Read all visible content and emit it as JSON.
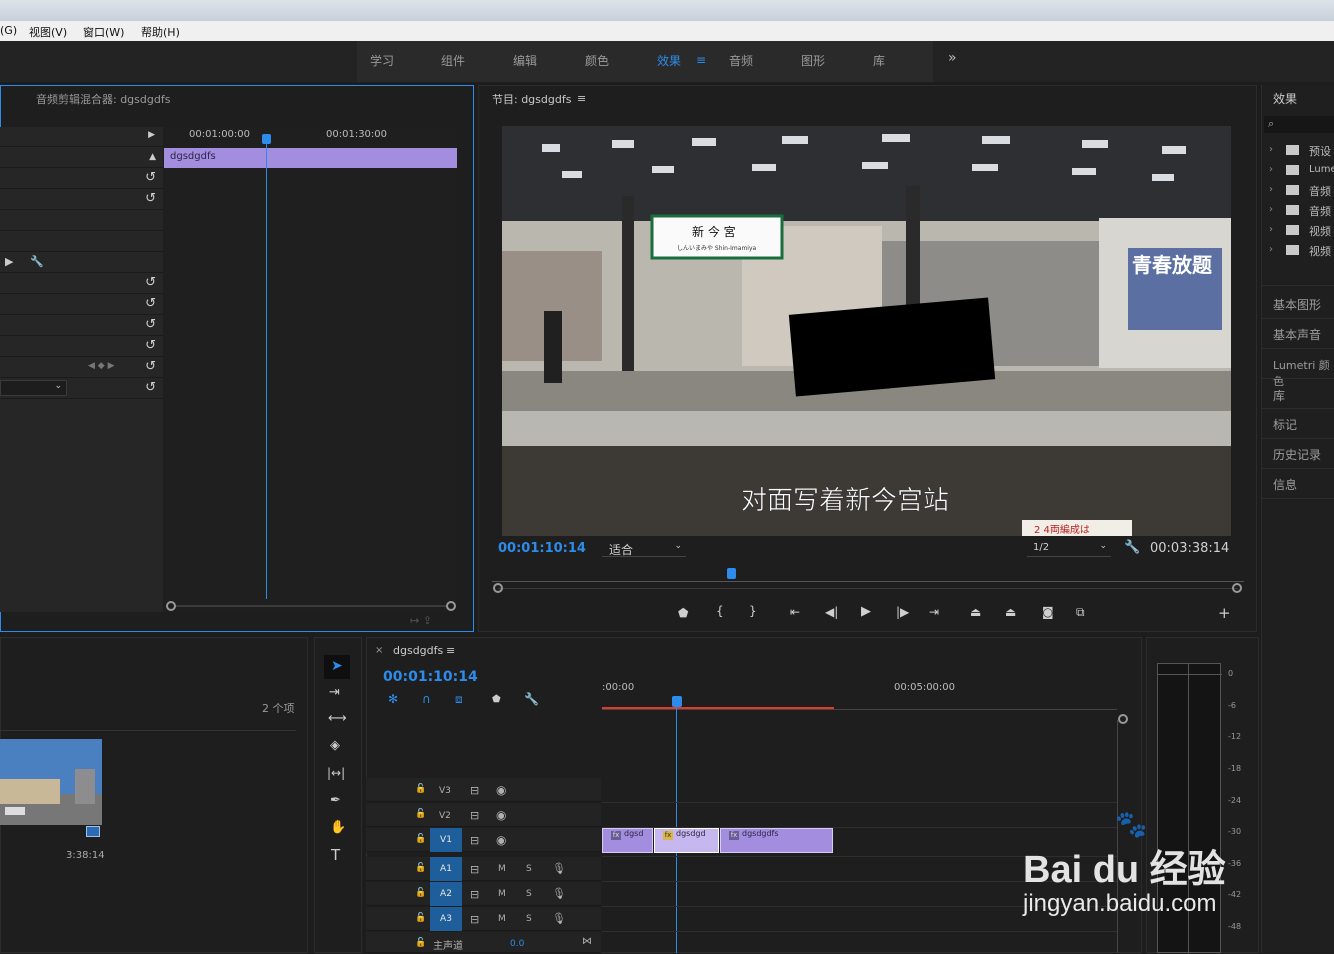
{
  "menu": [
    "(G)",
    "视图(V)",
    "窗口(W)",
    "帮助(H)"
  ],
  "workspaces": [
    "学习",
    "组件",
    "编辑",
    "颜色",
    "效果",
    "音频",
    "图形",
    "库"
  ],
  "active_workspace": "效果",
  "overflow_glyph": "»",
  "mixer": {
    "title": "音频剪辑混合器: dgsdgdfs",
    "ruler_times": [
      "00:01:00:00",
      "00:01:30:00"
    ],
    "clip_name": "dgsdgdfs"
  },
  "program": {
    "title": "节目: dgsdgdfs",
    "timecode": "00:01:10:14",
    "fit": "适合",
    "resolution": "1/2",
    "duration": "00:03:38:14",
    "subtitle": "对面写着新今宫站",
    "station_sign": "新 今 宮",
    "station_sign_sub": "しんいまみや  Shin-Imamiya",
    "poster_title": "青春放题",
    "bottom_sign": "2 4両編成は"
  },
  "effects_panel": {
    "title": "效果",
    "folders": [
      "预设",
      "Lume",
      "音频",
      "音频",
      "视频",
      "视频"
    ],
    "sections": [
      "基本图形",
      "基本声音",
      "Lumetri 颜色",
      "库",
      "标记",
      "历史记录",
      "信息"
    ]
  },
  "project": {
    "count": "2 个项",
    "thumb_duration": "3:38:14"
  },
  "timeline": {
    "tab_title": "dgsdgdfs",
    "timecode": "00:01:10:14",
    "ruler": [
      ":00:00",
      "00:05:00:00"
    ],
    "video_tracks": [
      "V3",
      "V2",
      "V1"
    ],
    "audio_tracks": [
      "A1",
      "A2",
      "A3"
    ],
    "audio_m": "M",
    "audio_s": "S",
    "master_label": "主声道",
    "master_value": "0.0",
    "clips": [
      "dgsd",
      "dgsdgd",
      "dgsdgdfs"
    ]
  },
  "meter": {
    "scale": [
      "0",
      "-6",
      "-12",
      "-18",
      "-24",
      "-30",
      "-36",
      "-42",
      "-48"
    ]
  },
  "watermark": {
    "brand": "Bai du 经验",
    "url": "jingyan.baidu.com"
  },
  "colors": {
    "accent": "#2d8ceb",
    "clip": "#a38ddf",
    "target": "#1e5e9b",
    "workarea": "#e03a2f"
  }
}
